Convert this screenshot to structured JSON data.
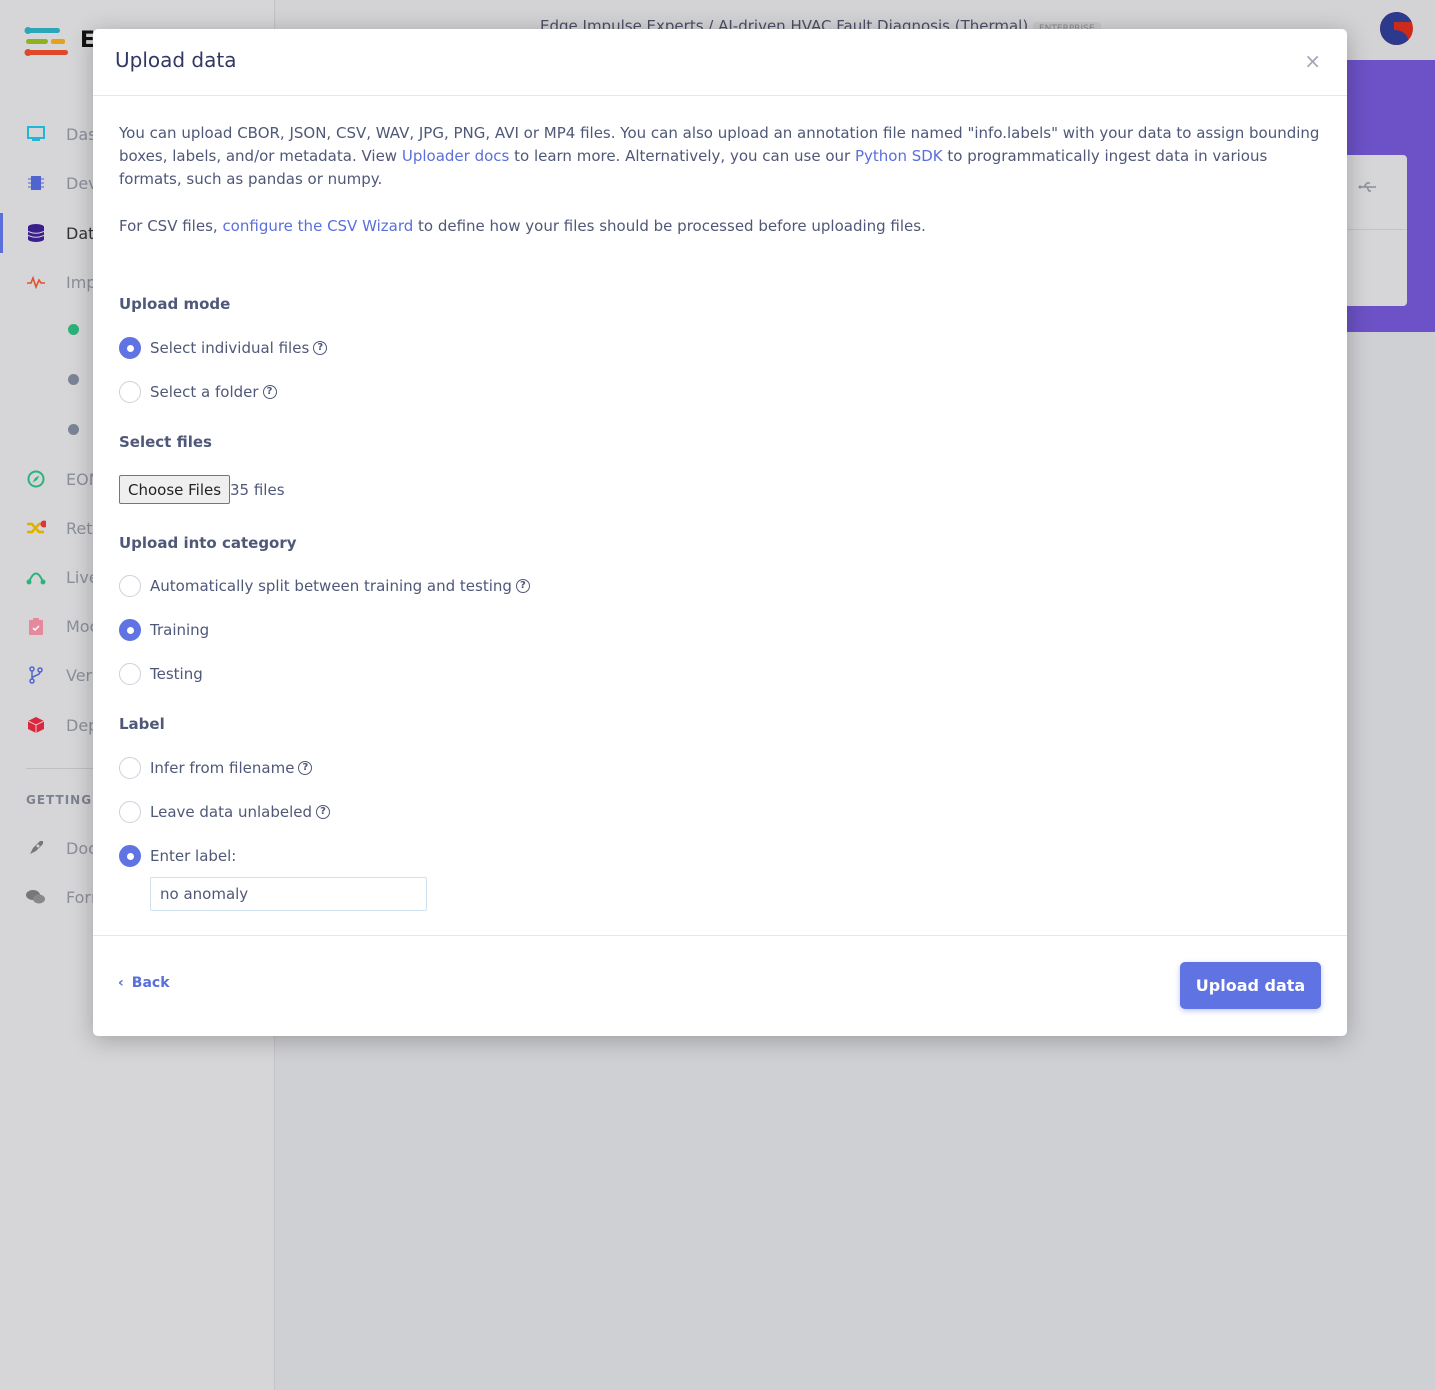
{
  "sidebar": {
    "logo_letter": "E",
    "items": [
      {
        "label": "Das",
        "icon": "monitor-icon",
        "color": "#21b6d7"
      },
      {
        "label": "Dev",
        "icon": "chip-icon",
        "color": "#5064d0"
      },
      {
        "label": "Dat",
        "icon": "database-icon",
        "color": "#3b1f8c",
        "active": true
      },
      {
        "label": "Imp",
        "icon": "pulse-icon",
        "color": "#e4502f"
      },
      {
        "label": "EON",
        "icon": "compass-icon",
        "color": "#2ab37a"
      },
      {
        "label": "Retr",
        "icon": "shuffle-icon",
        "color": "#e0b000"
      },
      {
        "label": "Live",
        "icon": "bezier-icon",
        "color": "#2ab37a"
      },
      {
        "label": "Moc",
        "icon": "clipboard-check-icon",
        "color": "#e58a9c"
      },
      {
        "label": "Vers",
        "icon": "branch-icon",
        "color": "#5064d0"
      },
      {
        "label": "Dep",
        "icon": "cube-icon",
        "color": "#d8283e"
      }
    ],
    "sub_dots": [
      "#2ab37a",
      "#7b8496",
      "#7b8496"
    ],
    "section_label": "GETTING S",
    "bottom_items": [
      {
        "label": "Doc",
        "icon": "rocket-icon"
      },
      {
        "label": "Forı",
        "icon": "chat-icon"
      }
    ]
  },
  "topbar": {
    "breadcrumb": "Edge Impulse Experts / AI-driven HVAC Fault Diagnosis (Thermal)",
    "badge": "ENTERPRISE"
  },
  "modal": {
    "title": "Upload data",
    "close": "×",
    "intro_1": "You can upload CBOR, JSON, CSV, WAV, JPG, PNG, AVI or MP4 files. You can also upload an annotation file named \"info.labels\" with your data to assign bounding boxes, labels, and/or metadata. View ",
    "uploader_docs_link": "Uploader docs",
    "intro_2": " to learn more. Alternatively, you can use our ",
    "python_sdk_link": "Python SDK",
    "intro_3": " to programmatically ingest data in various formats, such as pandas or numpy.",
    "csv_1": "For CSV files, ",
    "csv_link": "configure the CSV Wizard",
    "csv_2": " to define how your files should be processed before uploading files.",
    "upload_mode": {
      "heading": "Upload mode",
      "options": [
        {
          "label": "Select individual files",
          "selected": true
        },
        {
          "label": "Select a folder",
          "selected": false
        }
      ]
    },
    "select_files": {
      "heading": "Select files",
      "button": "Choose Files",
      "status": "35 files"
    },
    "category": {
      "heading": "Upload into category",
      "options": [
        {
          "label": "Automatically split between training and testing",
          "selected": false
        },
        {
          "label": "Training",
          "selected": true
        },
        {
          "label": "Testing",
          "selected": false
        }
      ]
    },
    "label": {
      "heading": "Label",
      "options": [
        {
          "label": "Infer from filename",
          "selected": false
        },
        {
          "label": "Leave data unlabeled",
          "selected": false
        },
        {
          "label": "Enter label:",
          "selected": true
        }
      ],
      "value": "no anomaly"
    },
    "back": "Back",
    "submit": "Upload data"
  },
  "colors": {
    "accent": "#5f73e3",
    "link": "#5a6fdb",
    "banner": "#6c52c6",
    "text": "#4f5878"
  }
}
